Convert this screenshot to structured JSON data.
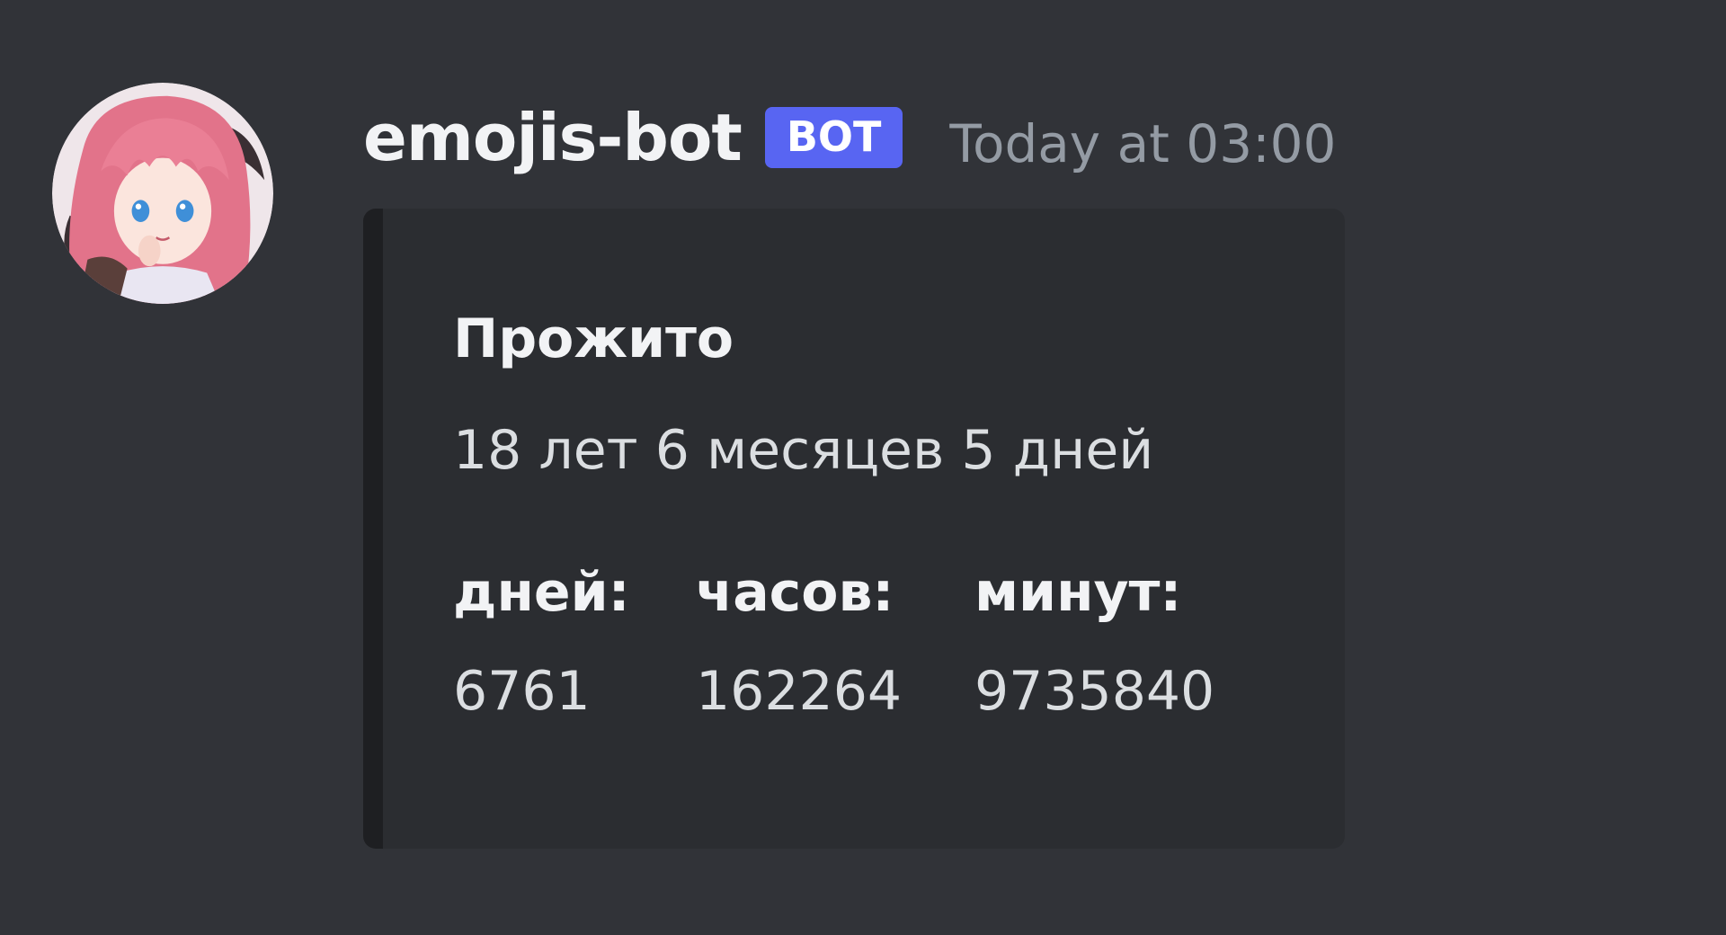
{
  "message": {
    "author": {
      "username": "emojis-bot",
      "bot_tag": "BOT",
      "avatar_icon": "anime-girl-avatar"
    },
    "timestamp": "Today at 03:00",
    "embed": {
      "title": "Прожито",
      "description": "18 лет 6 месяцев 5 дней",
      "fields": [
        {
          "name": "дней:",
          "value": "6761"
        },
        {
          "name": "часов:",
          "value": "162264"
        },
        {
          "name": "минут:",
          "value": "9735840"
        }
      ]
    }
  },
  "colors": {
    "background": "#313338",
    "embed_background": "#2b2d31",
    "embed_border": "#1e1f22",
    "bot_tag": "#5865f2",
    "username": "#f2f3f5",
    "timestamp": "#949ba4"
  }
}
